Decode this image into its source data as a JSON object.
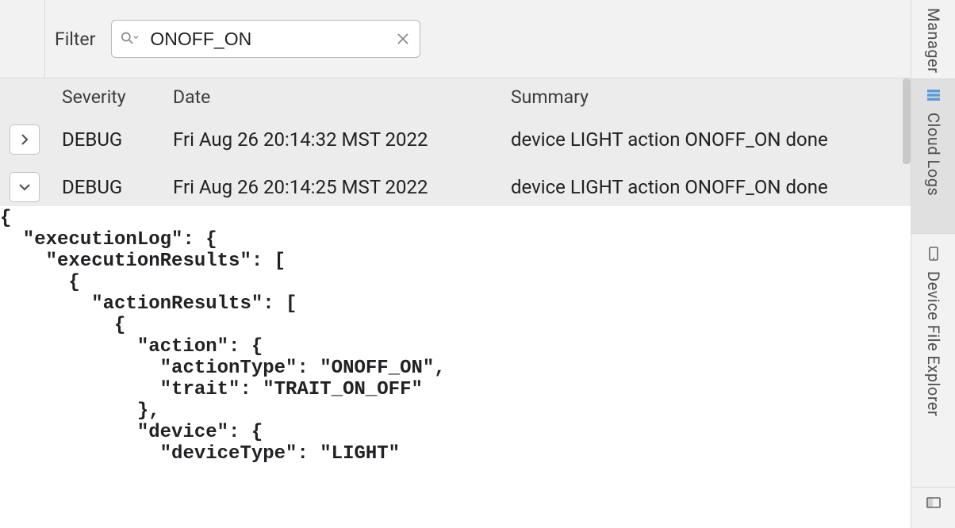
{
  "filter": {
    "label": "Filter",
    "value": "ONOFF_ON"
  },
  "table": {
    "headers": {
      "severity": "Severity",
      "date": "Date",
      "summary": "Summary"
    },
    "rows": [
      {
        "severity": "DEBUG",
        "date": "Fri Aug 26 20:14:32 MST 2022",
        "summary": "device LIGHT action ONOFF_ON done",
        "expanded": false
      },
      {
        "severity": "DEBUG",
        "date": "Fri Aug 26 20:14:25 MST 2022",
        "summary": "device LIGHT action ONOFF_ON done",
        "expanded": true
      }
    ]
  },
  "json_detail": "{\n  \"executionLog\": {\n    \"executionResults\": [\n      {\n        \"actionResults\": [\n          {\n            \"action\": {\n              \"actionType\": \"ONOFF_ON\",\n              \"trait\": \"TRAIT_ON_OFF\"\n            },\n            \"device\": {\n              \"deviceType\": \"LIGHT\"",
  "sidebar": {
    "manager": "Manager",
    "cloud_logs": "Cloud Logs",
    "device_file_explorer": "Device File Explorer"
  }
}
